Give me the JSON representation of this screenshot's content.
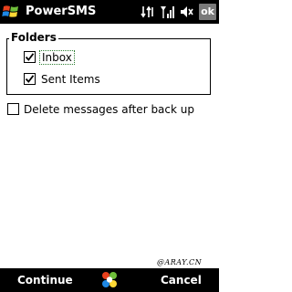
{
  "title_bar": {
    "app_title": "PowerSMS",
    "ok_label": "ok",
    "icons": [
      "windows-start-icon",
      "connectivity-icon",
      "signal-icon",
      "speaker-icon"
    ]
  },
  "folders": {
    "label": "Folders",
    "items": [
      {
        "label": "Inbox",
        "checked": true
      },
      {
        "label": "Sent Items",
        "checked": true
      }
    ]
  },
  "options": {
    "delete_after_backup": {
      "label": "Delete messages after back up",
      "checked": false
    }
  },
  "softkeys": {
    "left": "Continue",
    "right": "Cancel",
    "center_icon": "sip-keyboard-icon"
  },
  "watermark": "@ARAY.CN",
  "colors": {
    "bar_background": "#000000",
    "ok_background": "#7a7a7a",
    "focus_outline": "#2e7d32"
  }
}
